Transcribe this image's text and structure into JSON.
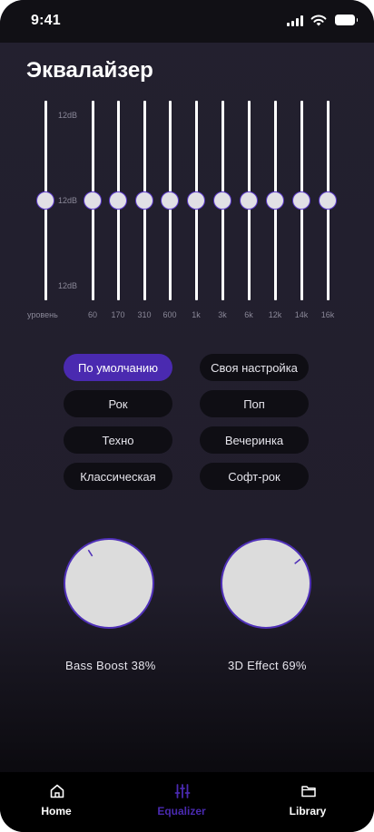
{
  "status": {
    "time": "9:41"
  },
  "screen": {
    "title": "Эквалайзер"
  },
  "equalizer": {
    "db_top": "12dB",
    "db_mid": "12dB",
    "db_bottom": "12dB",
    "level_label": "уровень",
    "bands": [
      "60",
      "170",
      "310",
      "600",
      "1k",
      "3k",
      "6k",
      "12k",
      "14k",
      "16k"
    ],
    "level_position": 0.5,
    "band_positions": [
      0.5,
      0.5,
      0.5,
      0.5,
      0.5,
      0.5,
      0.5,
      0.5,
      0.5,
      0.5
    ]
  },
  "presets": [
    {
      "label": "По умолчанию",
      "active": true
    },
    {
      "label": "Своя настройка",
      "active": false
    },
    {
      "label": "Рок",
      "active": false
    },
    {
      "label": "Поп",
      "active": false
    },
    {
      "label": "Техно",
      "active": false
    },
    {
      "label": "Вечеринка",
      "active": false
    },
    {
      "label": "Классическая",
      "active": false
    },
    {
      "label": "Софт-рок",
      "active": false
    }
  ],
  "effects": {
    "bass": {
      "label": "Bass Boost 38%",
      "value": 38
    },
    "effect3d": {
      "label": "3D Effect 69%",
      "value": 69
    }
  },
  "nav": {
    "items": [
      {
        "label": "Home",
        "icon": "home-icon",
        "active": false
      },
      {
        "label": "Equalizer",
        "icon": "equalizer-icon",
        "active": true
      },
      {
        "label": "Library",
        "icon": "folder-icon",
        "active": false
      }
    ]
  },
  "colors": {
    "accent": "#4a2ab0",
    "background": "#211e2c",
    "thumb": "#e1e0e5"
  }
}
